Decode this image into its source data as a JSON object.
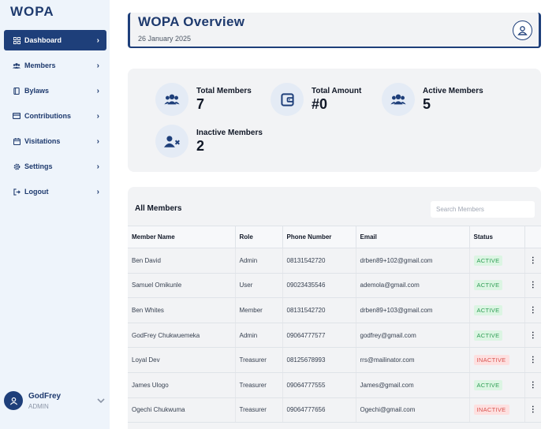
{
  "app": {
    "logo": "WOPA"
  },
  "sidebar": {
    "items": [
      {
        "label": "Dashboard",
        "icon": "grid-icon",
        "active": true
      },
      {
        "label": "Members",
        "icon": "users-icon"
      },
      {
        "label": "Bylaws",
        "icon": "book-icon"
      },
      {
        "label": "Contributions",
        "icon": "wallet-icon"
      },
      {
        "label": "Visitations",
        "icon": "calendar-icon"
      },
      {
        "label": "Settings",
        "icon": "gear-icon"
      },
      {
        "label": "Logout",
        "icon": "logout-icon"
      }
    ],
    "user": {
      "name": "GodFrey",
      "role": "ADMIN"
    }
  },
  "header": {
    "title": "WOPA Overview",
    "date": "26 January 2025"
  },
  "stats": [
    {
      "label": "Total Members",
      "value": "7",
      "icon": "users-icon"
    },
    {
      "label": "Total Amount",
      "value": "#0",
      "icon": "wallet-icon"
    },
    {
      "label": "Active Members",
      "value": "5",
      "icon": "users-icon"
    },
    {
      "label": "Inactive Members",
      "value": "2",
      "icon": "user-remove-icon"
    }
  ],
  "members": {
    "title": "All Members",
    "search_placeholder": "Search Members",
    "columns": [
      "Member Name",
      "Role",
      "Phone Number",
      "Email",
      "Status",
      ""
    ],
    "rows": [
      {
        "name": "Ben David",
        "role": "Admin",
        "phone": "08131542720",
        "email": "drben89+102@gmail.com",
        "status": "ACTIVE"
      },
      {
        "name": "Samuel Omikunle",
        "role": "User",
        "phone": "09023435546",
        "email": "ademola@gmail.com",
        "status": "ACTIVE"
      },
      {
        "name": "Ben Whites",
        "role": "Member",
        "phone": "08131542720",
        "email": "drben89+103@gmail.com",
        "status": "ACTIVE"
      },
      {
        "name": "GodFrey Chukwuemeka",
        "role": "Admin",
        "phone": "09064777577",
        "email": "godfrey@gmail.com",
        "status": "ACTIVE"
      },
      {
        "name": "Loyal Dev",
        "role": "Treasurer",
        "phone": "08125678993",
        "email": "rrs@mailinator.com",
        "status": "INACTIVE"
      },
      {
        "name": "James Ulogo",
        "role": "Treasurer",
        "phone": "09064777555",
        "email": "James@gmail.com",
        "status": "ACTIVE"
      },
      {
        "name": "Ogechi Chukwuma",
        "role": "Treasurer",
        "phone": "09064777656",
        "email": "Ogechi@gmail.com",
        "status": "INACTIVE"
      }
    ]
  },
  "colors": {
    "primary": "#1e3f7a",
    "active": "#2f9e55",
    "inactive": "#d9534f"
  }
}
